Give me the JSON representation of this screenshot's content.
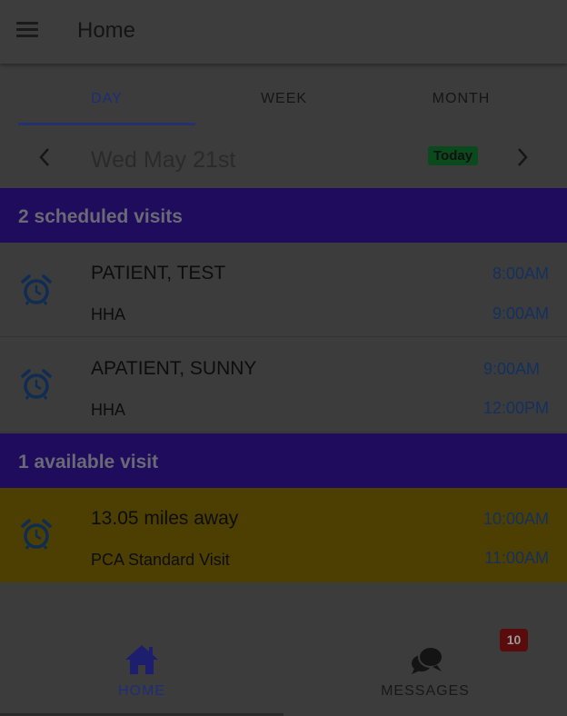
{
  "header": {
    "title": "Home",
    "menu_icon": "hamburger-menu-icon"
  },
  "tabs": [
    {
      "label": "DAY",
      "active": true
    },
    {
      "label": "WEEK",
      "active": false
    },
    {
      "label": "MONTH",
      "active": false
    }
  ],
  "date_nav": {
    "date": "Wed May 21st",
    "today_label": "Today",
    "prev_icon": "chevron-left-icon",
    "next_icon": "chevron-right-icon"
  },
  "scheduled": {
    "header": "2 scheduled visits",
    "visits": [
      {
        "name": "PATIENT, TEST",
        "type": "HHA",
        "start": "8:00AM",
        "end": "9:00AM"
      },
      {
        "name": "APATIENT, SUNNY",
        "type": "HHA",
        "start": "9:00AM",
        "end": "12:00PM"
      }
    ]
  },
  "available": {
    "header": "1 available visit",
    "visits": [
      {
        "name": "13.05 miles away",
        "type": "PCA Standard Visit",
        "start": "10:00AM",
        "end": "11:00AM"
      }
    ]
  },
  "bottom_nav": {
    "home_label": "HOME",
    "messages_label": "MESSAGES",
    "messages_badge": "10"
  },
  "colors": {
    "section_header_bg": "#1f0c5c",
    "available_row_bg": "#4d3f02",
    "today_badge_bg": "#0b4a1c",
    "active_tab": "#1e2c7a",
    "time_text": "#13305e",
    "badge_bg": "#5a0b0b"
  }
}
